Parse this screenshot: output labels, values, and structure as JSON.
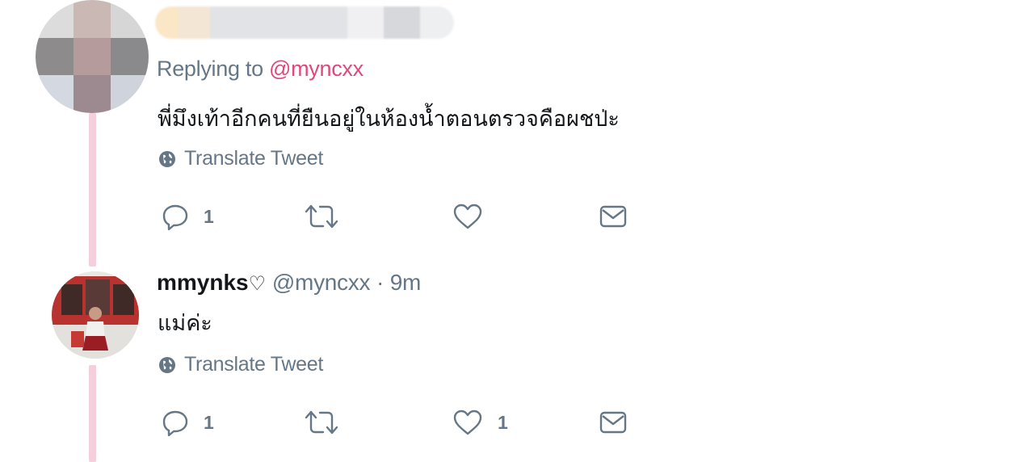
{
  "reply_tweet": {
    "replying_prefix": "Replying to",
    "replying_mention": "@myncxx",
    "text": "พี่มึงเท้าอีกคนที่ยืนอยู่ในห้องน้ำตอนตรวจคือผชป่ะ",
    "translate_label": "Translate Tweet",
    "actions": {
      "reply_count": "1",
      "retweet_count": "",
      "like_count": ""
    }
  },
  "tweet2": {
    "display_name": "mmynks",
    "name_emoji": "♡",
    "handle": "@myncxx",
    "separator": "·",
    "time": "9m",
    "text": "แม่ค่ะ",
    "translate_label": "Translate Tweet",
    "actions": {
      "reply_count": "1",
      "retweet_count": "",
      "like_count": "1"
    }
  },
  "colors": {
    "thread_line": "#f6cfdd",
    "mention": "#e0487c",
    "secondary_text": "#657786",
    "primary_text": "#14171a"
  },
  "icons": [
    "globe-icon",
    "reply-icon",
    "retweet-icon",
    "like-icon",
    "message-icon"
  ]
}
